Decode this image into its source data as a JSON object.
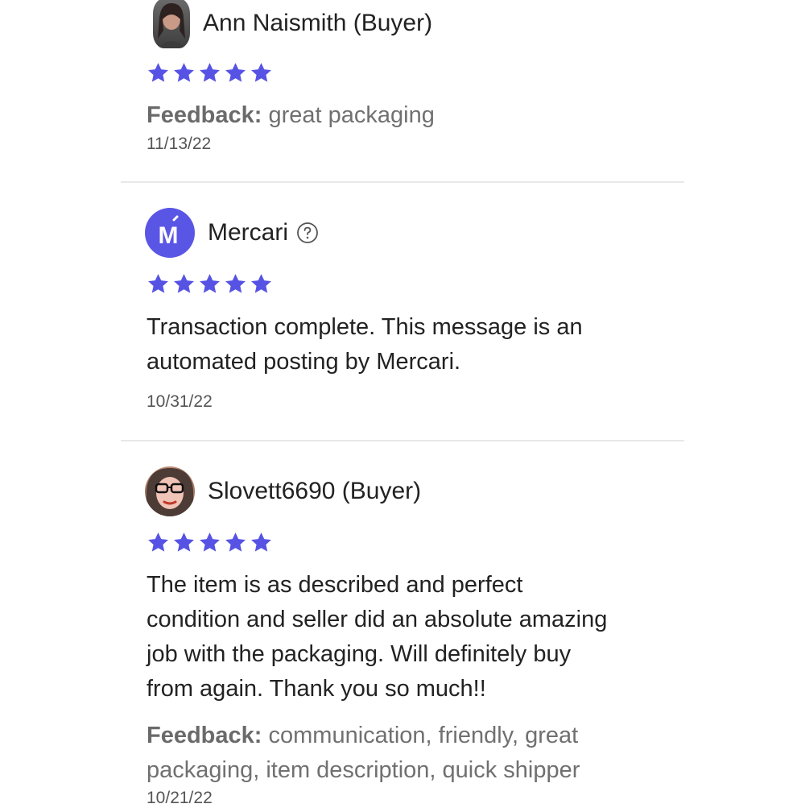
{
  "colors": {
    "star": "#5653e4",
    "brand": "#5a56e5",
    "divider": "#e8e8e8"
  },
  "reviews": [
    {
      "avatar": "user-photo-avatar",
      "name": "Ann Naismith (Buyer)",
      "rating": 5,
      "feedback_label": "Feedback:",
      "feedback": "great packaging",
      "date": "11/13/22"
    },
    {
      "avatar": "mercari-logo-avatar",
      "avatar_letter": "M",
      "name": "Mercari",
      "help_icon": "question-circle-icon",
      "rating": 5,
      "text_lines": [
        "Transaction complete. This message is an",
        "automated posting by Mercari."
      ],
      "date": "10/31/22"
    },
    {
      "avatar": "user-photo-avatar",
      "name": "Slovett6690 (Buyer)",
      "rating": 5,
      "text_lines": [
        "The item is as described and perfect",
        "condition and seller did an absolute amazing",
        "job with the packaging. Will definitely buy",
        "from again. Thank you so much!!"
      ],
      "feedback_label": "Feedback:",
      "feedback_lines": [
        "communication, friendly, great",
        "packaging, item description, quick shipper"
      ],
      "date": "10/21/22"
    }
  ]
}
